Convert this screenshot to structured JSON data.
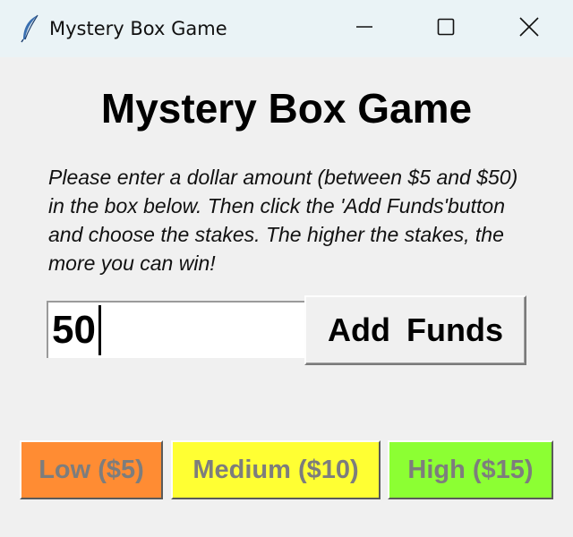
{
  "window": {
    "title": "Mystery Box Game",
    "icon": "feather-icon",
    "controls": [
      "minimize-icon",
      "maximize-icon",
      "close-icon"
    ]
  },
  "main": {
    "heading": "Mystery Box Game",
    "instructions": "Please enter a dollar amount (between $5 and $50) in the box below.  Then click the 'Add Funds'button and choose the stakes.  The higher the stakes, the more you can win!",
    "amount_input": {
      "value": "50",
      "placeholder": ""
    },
    "add_funds_label": "Add Funds"
  },
  "stakes": [
    {
      "label": "Low ($5)",
      "color": "#ff8c33"
    },
    {
      "label": "Medium ($10)",
      "color": "#ffff33"
    },
    {
      "label": "High ($15)",
      "color": "#8cff33"
    }
  ],
  "colors": {
    "titlebar": "#eaf3f6",
    "background": "#f0f0f0",
    "disabled_text": "#7d7d7d"
  }
}
